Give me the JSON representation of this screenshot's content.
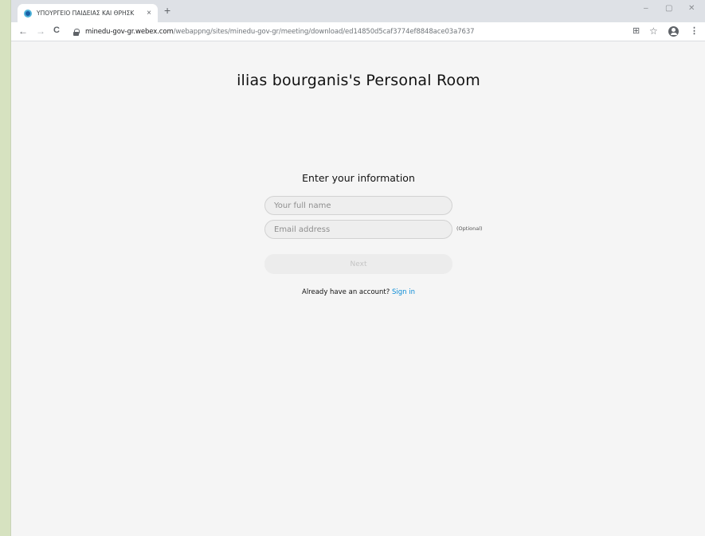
{
  "browser": {
    "tab_title": "ΥΠΟΥΡΓΕΙΟ ΠΑΙΔΕΙΑΣ ΚΑΙ ΘΡΗΣΚ",
    "tab_close": "×",
    "new_tab": "+",
    "window_controls": {
      "minimize": "–",
      "restore": "▢",
      "close": "✕"
    },
    "nav": {
      "back": "←",
      "forward": "→",
      "reload": "C"
    },
    "url_host": "minedu-gov-gr.webex.com",
    "url_path": "/webappng/sites/minedu-gov-gr/meeting/download/ed14850d5caf3774ef8848ace03a7637",
    "toolbar_icons": {
      "translate": "⊞",
      "star": "☆",
      "menu": "⋮"
    }
  },
  "page": {
    "room_title": "ilias bourganis's Personal Room",
    "form_heading": "Enter your information",
    "name_placeholder": "Your full name",
    "email_placeholder": "Email address",
    "optional_label": "(Optional)",
    "next_label": "Next",
    "account_prompt": "Already have an account?",
    "sign_in_label": "Sign in"
  },
  "colors": {
    "link": "#0a8bd6",
    "page_background": "#f5f5f5",
    "disabled_button": "#ececec"
  }
}
